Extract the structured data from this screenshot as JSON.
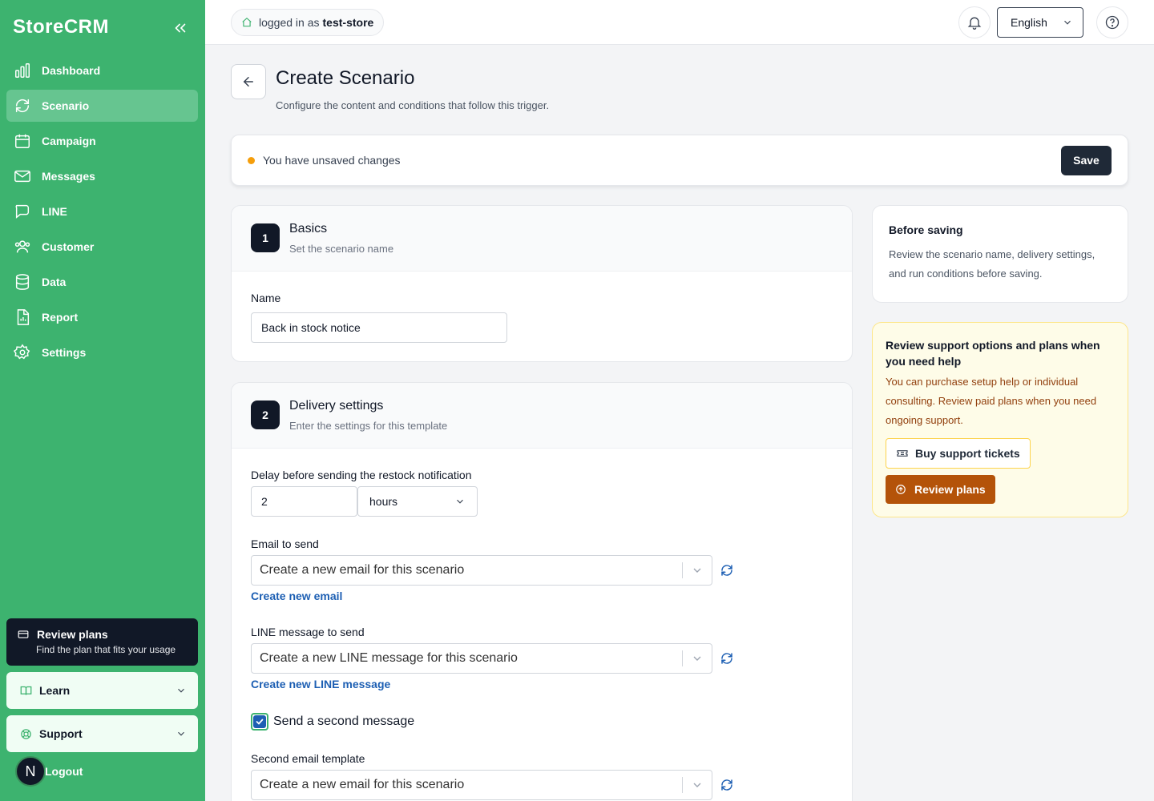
{
  "sidebar": {
    "brand": "StoreCRM",
    "items": [
      {
        "label": "Dashboard",
        "icon": "bar-chart-icon"
      },
      {
        "label": "Scenario",
        "icon": "refresh-icon"
      },
      {
        "label": "Campaign",
        "icon": "calendar-icon"
      },
      {
        "label": "Messages",
        "icon": "mail-icon"
      },
      {
        "label": "LINE",
        "icon": "chat-icon"
      },
      {
        "label": "Customer",
        "icon": "users-icon"
      },
      {
        "label": "Data",
        "icon": "database-icon"
      },
      {
        "label": "Report",
        "icon": "file-chart-icon"
      },
      {
        "label": "Settings",
        "icon": "gear-icon"
      }
    ],
    "active_item": "Scenario",
    "plan_card": {
      "title": "Review plans",
      "subtitle": "Find the plan that fits your usage"
    },
    "learn_label": "Learn",
    "support_label": "Support",
    "logout_label": "Logout",
    "avatar_letter": "N"
  },
  "header": {
    "login_prefix": "logged in as",
    "store_name": "test-store",
    "language": "English"
  },
  "page": {
    "title": "Create Scenario",
    "subtitle": "Configure the content and conditions that follow this trigger."
  },
  "unsaved_bar": {
    "message": "You have unsaved changes",
    "save_label": "Save"
  },
  "basics": {
    "step": "1",
    "title": "Basics",
    "subtitle": "Set the scenario name",
    "name_label": "Name",
    "name_value": "Back in stock notice"
  },
  "delivery": {
    "step": "2",
    "title": "Delivery settings",
    "subtitle": "Enter the settings for this template",
    "delay_label": "Delay before sending the restock notification",
    "delay_value": "2",
    "delay_unit": "hours",
    "email_label": "Email to send",
    "email_value": "Create a new email for this scenario",
    "email_link": "Create new email",
    "line_label": "LINE message to send",
    "line_value": "Create a new LINE message for this scenario",
    "line_link": "Create new LINE message",
    "second_checkbox_label": "Send a second message",
    "second_checked": true,
    "second_email_label": "Second email template",
    "second_email_value": "Create a new email for this scenario"
  },
  "side": {
    "title": "Before saving",
    "body": "Review the scenario name, delivery settings, and run conditions before saving."
  },
  "help": {
    "title": "Review support options and plans when you need help",
    "body": "You can purchase setup help or individual consulting. Review paid plans when you need ongoing support.",
    "tickets_label": "Buy support tickets",
    "plans_label": "Review plans"
  },
  "colors": {
    "sidebar": "#3db36f",
    "sidebar_active": "#66c590",
    "dark": "#111827",
    "link": "#1d5fb3",
    "warning_dot": "#f59e0b",
    "plans_button": "#b45309"
  }
}
